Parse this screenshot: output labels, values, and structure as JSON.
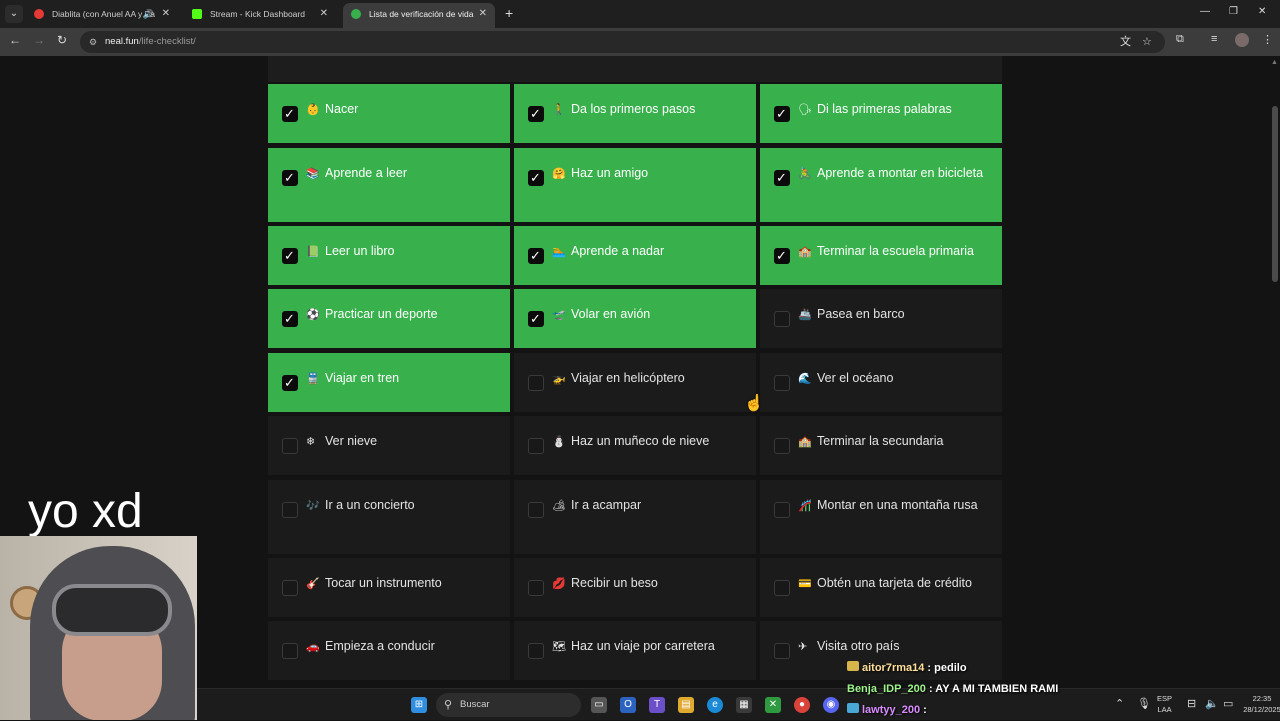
{
  "browser": {
    "tabs": [
      {
        "title": "Diablita (con Anuel AA y Ba",
        "favicon_color": "#e53935",
        "has_speaker": true
      },
      {
        "title": "Stream - Kick Dashboard",
        "favicon_color": "#53fc18",
        "has_speaker": false
      },
      {
        "title": "Lista de verificación de vida",
        "favicon_color": "#38b14d",
        "has_speaker": false
      }
    ],
    "url_host": "neal.fun",
    "url_path": "/life-checklist/"
  },
  "checklist": [
    {
      "label": "Nacer",
      "emoji": "👶",
      "done": true
    },
    {
      "label": "Da los primeros pasos",
      "emoji": "🚶",
      "done": true
    },
    {
      "label": "Di las primeras palabras",
      "emoji": "🗣",
      "done": true
    },
    {
      "label": "Aprende a leer",
      "emoji": "📚",
      "done": true
    },
    {
      "label": "Haz un amigo",
      "emoji": "🤗",
      "done": true
    },
    {
      "label": "Aprende a montar en bicicleta",
      "emoji": "🚴",
      "done": true
    },
    {
      "label": "Leer un libro",
      "emoji": "📗",
      "done": true
    },
    {
      "label": "Aprende a nadar",
      "emoji": "🏊",
      "done": true
    },
    {
      "label": "Terminar la escuela primaria",
      "emoji": "🏫",
      "done": true
    },
    {
      "label": "Practicar un deporte",
      "emoji": "⚽",
      "done": true
    },
    {
      "label": "Volar en avión",
      "emoji": "🛫",
      "done": true
    },
    {
      "label": "Pasea en barco",
      "emoji": "🚢",
      "done": false
    },
    {
      "label": "Viajar en tren",
      "emoji": "🚆",
      "done": true
    },
    {
      "label": "Viajar en helicóptero",
      "emoji": "🚁",
      "done": false
    },
    {
      "label": "Ver el océano",
      "emoji": "🌊",
      "done": false
    },
    {
      "label": "Ver nieve",
      "emoji": "❄",
      "done": false
    },
    {
      "label": "Haz un muñeco de nieve",
      "emoji": "⛄",
      "done": false
    },
    {
      "label": "Terminar la secundaria",
      "emoji": "🏫",
      "done": false
    },
    {
      "label": "Ir a un concierto",
      "emoji": "🎶",
      "done": false
    },
    {
      "label": "Ir a acampar",
      "emoji": "🏕",
      "done": false
    },
    {
      "label": "Montar en una montaña rusa",
      "emoji": "🎢",
      "done": false
    },
    {
      "label": "Tocar un instrumento",
      "emoji": "🎸",
      "done": false
    },
    {
      "label": "Recibir un beso",
      "emoji": "💋",
      "done": false
    },
    {
      "label": "Obtén una tarjeta de crédito",
      "emoji": "💳",
      "done": false
    },
    {
      "label": "Empieza a conducir",
      "emoji": "🚗",
      "done": false
    },
    {
      "label": "Haz un viaje por carretera",
      "emoji": "🗺",
      "done": false
    },
    {
      "label": "Visita otro país",
      "emoji": "✈",
      "done": false
    }
  ],
  "overlay": {
    "caption": "yo xd"
  },
  "chat": [
    {
      "user": "aitor7rma14",
      "message": "pedilo"
    },
    {
      "user": "Benja_IDP_200",
      "message": "AY A MI TAMBIEN RAMI"
    },
    {
      "user": "lawtyy_200",
      "message": ""
    }
  ],
  "taskbar": {
    "search_placeholder": "Buscar",
    "lang_line1": "ESP",
    "lang_line2": "LAA",
    "time": "22:35",
    "date": "28/12/2025"
  }
}
